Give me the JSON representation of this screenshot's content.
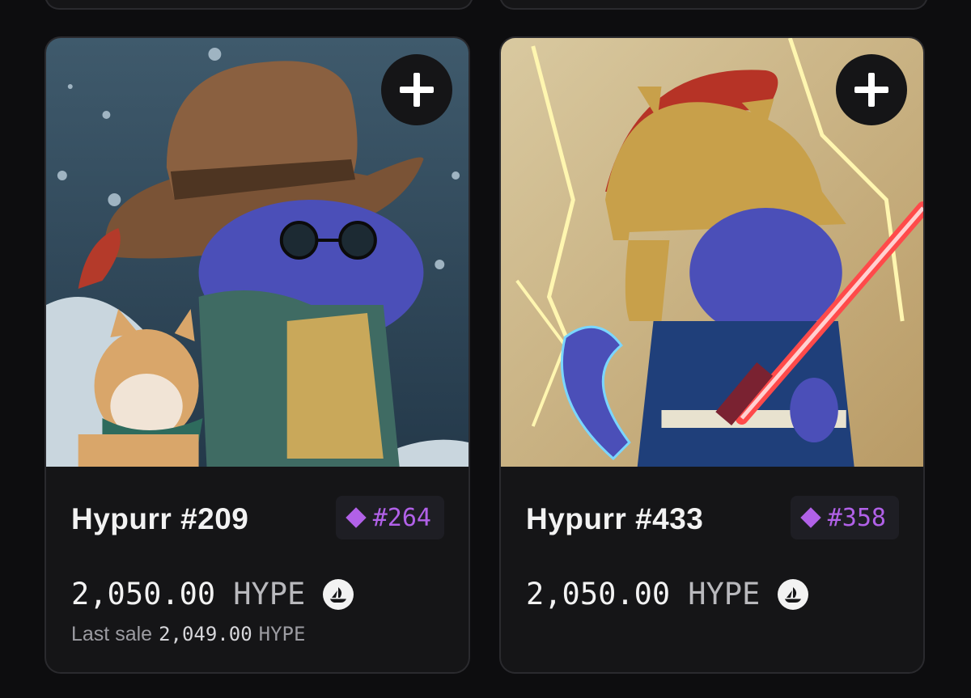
{
  "cards": [
    {
      "title": "Hypurr #209",
      "rank": "#264",
      "price": "2,050.00",
      "currency": "HYPE",
      "last_sale_label": "Last sale",
      "last_sale_value": "2,049.00",
      "last_sale_currency": "HYPE",
      "image_subject": "blue cat wearing cowboy hat, round sunglasses and green jacket, with shiba dog companion",
      "add_icon": "plus-icon",
      "marketplace_icon": "opensea-icon"
    },
    {
      "title": "Hypurr #433",
      "rank": "#358",
      "price": "2,050.00",
      "currency": "HYPE",
      "image_subject": "blue cat wearing golden spartan helmet with red plume, holding red lightsaber",
      "add_icon": "plus-icon",
      "marketplace_icon": "opensea-icon"
    }
  ],
  "colors": {
    "background": "#0d0d0f",
    "card": "#151517",
    "rank_accent": "#b161e8"
  }
}
